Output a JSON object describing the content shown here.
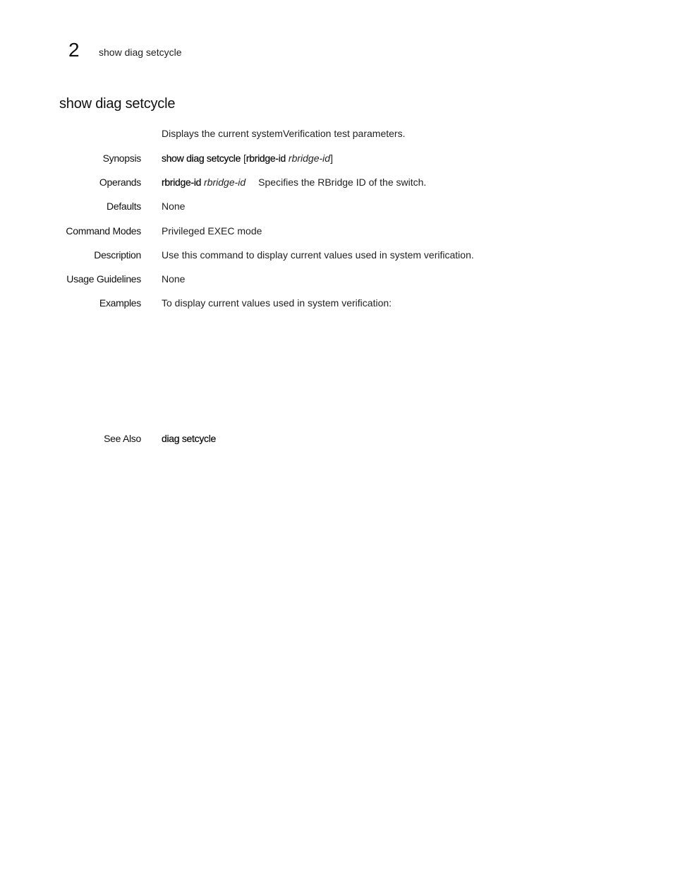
{
  "header": {
    "chapter_number": "2",
    "running_title": "show diag setcycle"
  },
  "page_title": "show diag setcycle",
  "intro": "Displays the current systemVerification test parameters.",
  "synopsis": {
    "label": "Synopsis",
    "command": "show diag setcycle",
    "open_bracket": "[",
    "keyword": "rbridge-id",
    "argument": "rbridge-id",
    "close_bracket": "]"
  },
  "operands": {
    "label": "Operands",
    "keyword": "rbridge-id",
    "argument": "rbridge-id",
    "description": "Specifies the RBridge ID of the switch."
  },
  "defaults": {
    "label": "Defaults",
    "value": "None"
  },
  "command_modes": {
    "label": "Command Modes",
    "value": "Privileged EXEC mode"
  },
  "description": {
    "label": "Description",
    "value": "Use this command to display current values used in system verification."
  },
  "usage_guidelines": {
    "label": "Usage Guidelines",
    "value": "None"
  },
  "examples": {
    "label": "Examples",
    "value": "To display current values used in system verification:"
  },
  "see_also": {
    "label": "See Also",
    "link": "diag setcycle"
  }
}
